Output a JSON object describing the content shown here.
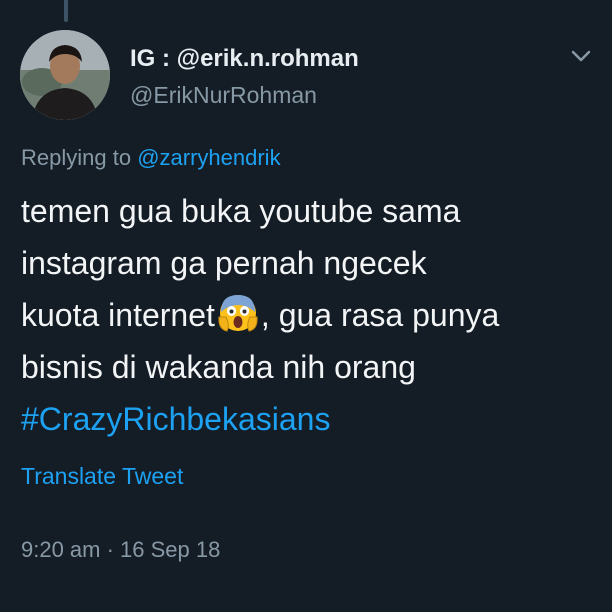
{
  "tweet": {
    "display_name": "IG : @erik.n.rohman",
    "handle": "@ErikNurRohman",
    "replying_prefix": "Replying to ",
    "replying_to": "@zarryhendrik",
    "text_line_1": "temen gua buka youtube sama",
    "text_line_2": "instagram ga pernah ngecek",
    "text_line_3a": "kuota internet",
    "text_line_3b": ",  gua rasa punya",
    "text_line_4": "bisnis di wakanda nih orang",
    "hashtag": "#CrazyRichbekasians",
    "emoji_icon": "screaming-face-emoji",
    "translate_label": "Translate Tweet",
    "timestamp": "9:20 am · 16 Sep 18"
  },
  "colors": {
    "background": "#141d26",
    "link": "#1da1f2",
    "secondary_text": "#8899a6",
    "primary_text": "#f2f4f6"
  }
}
